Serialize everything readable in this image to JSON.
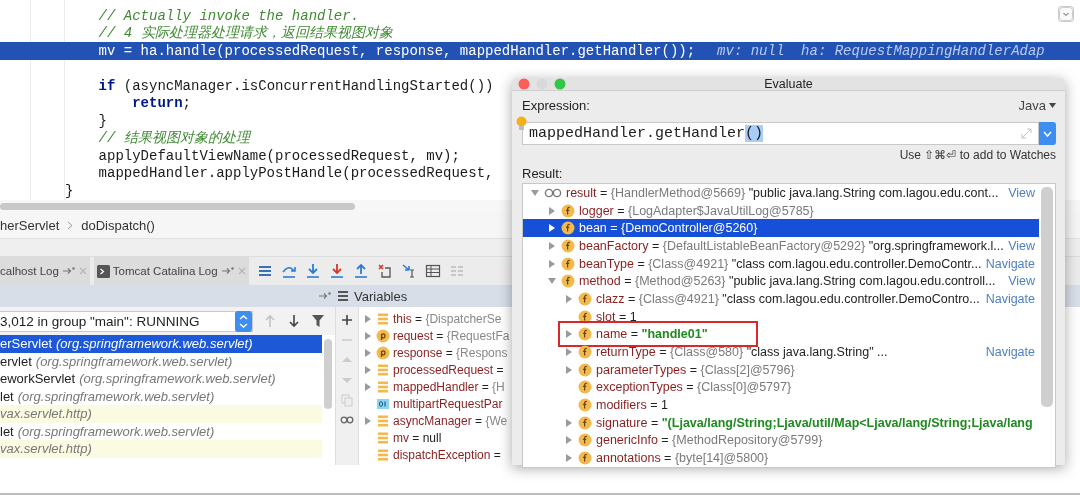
{
  "editor": {
    "lines": [
      {
        "kind": "block",
        "children": [
          {
            "kind": "comment",
            "text": "// Actually invoke the handler.",
            "highlighted": false
          },
          {
            "kind": "comment",
            "text": "// 4 实际处理器处理请求，返回结果视图对象",
            "highlighted": false
          },
          {
            "kind": "code",
            "text": "mv = ha.handle(processedRequest, response, mappedHandler.getHandler());",
            "highlighted": true,
            "hint": "mv: null  ha: RequestMappingHandlerAdap"
          },
          {
            "kind": "blank"
          },
          {
            "kind": "code",
            "text": "**if** (asyncManager.isConcurrentHandlingStarted())",
            "highlighted": false,
            "children": [
              {
                "kind": "code",
                "text": "**return**;",
                "highlighted": false
              }
            ]
          },
          {
            "kind": "code",
            "text": "}",
            "highlighted": false
          },
          {
            "kind": "comment",
            "text": "// 结果视图对象的处理",
            "highlighted": false
          },
          {
            "kind": "code",
            "text": "applyDefaultViewName(processedRequest, mv);",
            "highlighted": false
          },
          {
            "kind": "code",
            "text": "mappedHandler.applyPostHandle(processedRequest,",
            "highlighted": false
          }
        ]
      },
      {
        "kind": "code",
        "text": "}",
        "highlighted": false
      }
    ]
  },
  "debugger": {
    "breadcrumb": [
      "herServlet",
      "doDispatch()"
    ],
    "tabs": [
      {
        "label": "calhost Log"
      },
      {
        "label": "Tomcat Catalina Log"
      }
    ],
    "panel_title": "Variables",
    "thread": "3,012 in group \"main\": RUNNING",
    "frames": [
      {
        "method": "erServlet",
        "package": "(org.springframework.web.servlet)",
        "selected": true,
        "library": false
      },
      {
        "method": "ervlet",
        "package": "(org.springframework.web.servlet)",
        "selected": false,
        "library": false
      },
      {
        "method": "eworkServlet",
        "package": "(org.springframework.web.servlet)",
        "selected": false,
        "library": false
      },
      {
        "method": "let",
        "package": "(org.springframework.web.servlet)",
        "selected": false,
        "library": false
      },
      {
        "package": "vax.servlet.http)",
        "selected": false,
        "library": true
      },
      {
        "method": "let",
        "package": "(org.springframework.web.servlet)",
        "selected": false,
        "library": false
      },
      {
        "package": "vax.servlet.http)",
        "selected": false,
        "library": true
      }
    ],
    "variables": [
      {
        "kind": "local",
        "name": "this",
        "op": "=",
        "ref": "{DispatcherSe",
        "expanded": false
      },
      {
        "kind": "param",
        "name": "request",
        "op": "=",
        "ref": "{RequestFa",
        "expanded": false
      },
      {
        "kind": "param",
        "name": "response",
        "op": "=",
        "ref": "{Respons",
        "expanded": false
      },
      {
        "kind": "local",
        "name": "processedRequest",
        "op": "=",
        "expanded": false
      },
      {
        "kind": "local",
        "name": "mappedHandler",
        "op": "=",
        "ref": "{H",
        "expanded": false
      },
      {
        "kind": "primitive",
        "name": "multipartRequestPar"
      },
      {
        "kind": "local",
        "name": "asyncManager",
        "op": "=",
        "ref": "{We",
        "expanded": false
      },
      {
        "kind": "local",
        "name": "mv",
        "op": "=",
        "value": "null"
      },
      {
        "kind": "local",
        "name": "dispatchException",
        "op": "="
      }
    ]
  },
  "dialog": {
    "title": "Evaluate",
    "expression_label": "Expression:",
    "language": "Java",
    "expression": {
      "text": "mappedHandler.getHandler",
      "selected_text": "()"
    },
    "hint": "Use ⇧⌘⏎ to add to Watches",
    "result_label": "Result:",
    "tree": [
      {
        "kind": "watch",
        "name": "result",
        "op": "=",
        "ref": "{HandlerMethod@5669}",
        "value": "\"public java.lang.String com.lagou.edu.cont...",
        "quoted": false,
        "link": "View",
        "expanded": true,
        "selected": false,
        "boxed": false,
        "children": [
          {
            "kind": "field",
            "name": "logger",
            "op": "=",
            "ref": "{LogAdapter$JavaUtilLog@5785}",
            "expanded": false,
            "selected": false,
            "boxed": false
          },
          {
            "kind": "field",
            "name": "bean",
            "op": "=",
            "ref": "{DemoController@5260}",
            "expanded": false,
            "selected": true,
            "boxed": false
          },
          {
            "kind": "field",
            "name": "beanFactory",
            "op": "=",
            "ref": "{DefaultListableBeanFactory@5292}",
            "value": "\"org.springframework.l...",
            "quoted": false,
            "link": "View",
            "expanded": false,
            "selected": false,
            "boxed": false
          },
          {
            "kind": "field",
            "name": "beanType",
            "op": "=",
            "ref": "{Class@4921}",
            "value": "\"class com.lagou.edu.controller.DemoContr...",
            "quoted": false,
            "link": "Navigate",
            "expanded": false,
            "selected": false,
            "boxed": false
          },
          {
            "kind": "field",
            "name": "method",
            "op": "=",
            "ref": "{Method@5263}",
            "value": "\"public java.lang.String com.lagou.edu.controll...",
            "quoted": false,
            "link": "View",
            "expanded": true,
            "selected": false,
            "boxed": false,
            "children": [
              {
                "kind": "field",
                "name": "clazz",
                "op": "=",
                "ref": "{Class@4921}",
                "value": "\"class com.lagou.edu.controller.DemoContro...",
                "quoted": false,
                "link": "Navigate",
                "expanded": false,
                "selected": false,
                "boxed": false
              },
              {
                "kind": "field",
                "name": "slot",
                "op": "=",
                "value": "1",
                "quoted": false,
                "selected": false,
                "boxed": false
              },
              {
                "kind": "field",
                "name": "name",
                "op": "=",
                "value": "\"handle01\"",
                "quoted": true,
                "expanded": false,
                "selected": false,
                "boxed": true
              },
              {
                "kind": "field",
                "name": "returnType",
                "op": "=",
                "ref": "{Class@580}",
                "value": "\"class java.lang.String\" ...",
                "quoted": false,
                "link": "Navigate",
                "expanded": false,
                "selected": false,
                "boxed": false
              },
              {
                "kind": "field",
                "name": "parameterTypes",
                "op": "=",
                "ref": "{Class[2]@5796}",
                "expanded": false,
                "selected": false,
                "boxed": false
              },
              {
                "kind": "field",
                "name": "exceptionTypes",
                "op": "=",
                "ref": "{Class[0]@5797}",
                "selected": false,
                "boxed": false
              },
              {
                "kind": "field",
                "name": "modifiers",
                "op": "=",
                "value": "1",
                "quoted": false,
                "selected": false,
                "boxed": false
              },
              {
                "kind": "field",
                "name": "signature",
                "op": "=",
                "value": "\"(Ljava/lang/String;Ljava/util/Map<Ljava/lang/String;Ljava/lang",
                "quoted": true,
                "expanded": false,
                "selected": false,
                "boxed": false
              },
              {
                "kind": "field",
                "name": "genericInfo",
                "op": "=",
                "ref": "{MethodRepository@5799}",
                "expanded": false,
                "selected": false,
                "boxed": false
              },
              {
                "kind": "field",
                "name": "annotations",
                "op": "=",
                "ref": "{byte[14]@5800}",
                "expanded": false,
                "selected": false,
                "boxed": false
              }
            ]
          }
        ]
      }
    ]
  }
}
